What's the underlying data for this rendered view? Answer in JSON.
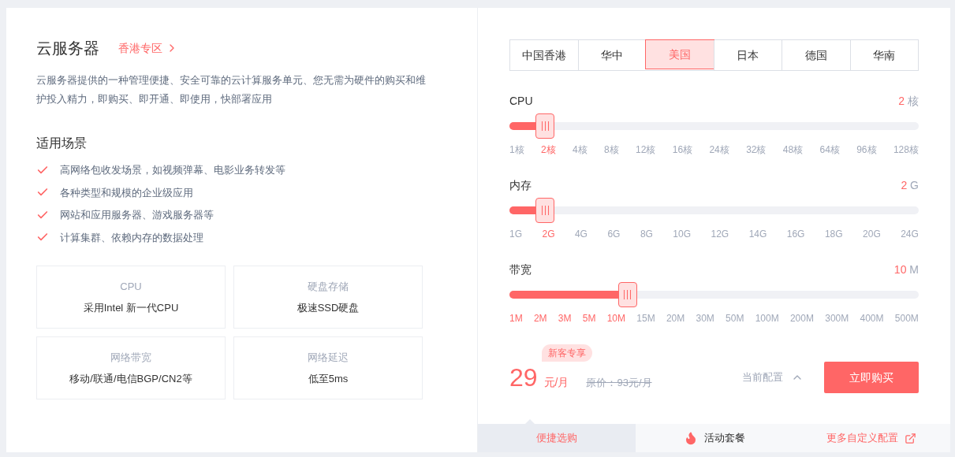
{
  "product": {
    "title": "云服务器",
    "zone_link": "香港专区",
    "description": "云服务器提供的一种管理便捷、安全可靠的云计算服务单元、您无需为硬件的购买和维护投入精力，即购买、即开通、即使用，快部署应用"
  },
  "scenarios": {
    "title": "适用场景",
    "items": [
      "高网络包收发场景，如视频弹幕、电影业务转发等",
      "各种类型和规模的企业级应用",
      "网站和应用服务器、游戏服务器等",
      "计算集群、依赖内存的数据处理"
    ]
  },
  "features": [
    {
      "label": "CPU",
      "value": "采用Intel 新一代CPU"
    },
    {
      "label": "硬盘存储",
      "value": "极速SSD硬盘"
    },
    {
      "label": "网络带宽",
      "value": "移动/联通/电信BGP/CN2等"
    },
    {
      "label": "网络延迟",
      "value": "低至5ms"
    }
  ],
  "regions": [
    {
      "label": "中国香港",
      "selected": false
    },
    {
      "label": "华中",
      "selected": false
    },
    {
      "label": "美国",
      "selected": true
    },
    {
      "label": "日本",
      "selected": false
    },
    {
      "label": "德国",
      "selected": false
    },
    {
      "label": "华南",
      "selected": false
    }
  ],
  "sliders": [
    {
      "label": "CPU",
      "value": "2",
      "unit": "核",
      "level": 0.087,
      "ticks": [
        {
          "text": "1核",
          "active": false
        },
        {
          "text": "2核",
          "active": true
        },
        {
          "text": "4核",
          "active": false
        },
        {
          "text": "8核",
          "active": false
        },
        {
          "text": "12核",
          "active": false
        },
        {
          "text": "16核",
          "active": false
        },
        {
          "text": "24核",
          "active": false
        },
        {
          "text": "32核",
          "active": false
        },
        {
          "text": "48核",
          "active": false
        },
        {
          "text": "64核",
          "active": false
        },
        {
          "text": "96核",
          "active": false
        },
        {
          "text": "128核",
          "active": false
        }
      ]
    },
    {
      "label": "内存",
      "value": "2",
      "unit": "G",
      "level": 0.087,
      "ticks": [
        {
          "text": "1G",
          "active": false
        },
        {
          "text": "2G",
          "active": true
        },
        {
          "text": "4G",
          "active": false
        },
        {
          "text": "6G",
          "active": false
        },
        {
          "text": "8G",
          "active": false
        },
        {
          "text": "10G",
          "active": false
        },
        {
          "text": "12G",
          "active": false
        },
        {
          "text": "14G",
          "active": false
        },
        {
          "text": "16G",
          "active": false
        },
        {
          "text": "18G",
          "active": false
        },
        {
          "text": "20G",
          "active": false
        },
        {
          "text": "24G",
          "active": false
        }
      ]
    },
    {
      "label": "带宽",
      "value": "10",
      "unit": "M",
      "level": 0.289,
      "ticks": [
        {
          "text": "1M",
          "active": true
        },
        {
          "text": "2M",
          "active": true
        },
        {
          "text": "3M",
          "active": true
        },
        {
          "text": "5M",
          "active": true
        },
        {
          "text": "10M",
          "active": true
        },
        {
          "text": "15M",
          "active": false
        },
        {
          "text": "20M",
          "active": false
        },
        {
          "text": "30M",
          "active": false
        },
        {
          "text": "50M",
          "active": false
        },
        {
          "text": "100M",
          "active": false
        },
        {
          "text": "200M",
          "active": false
        },
        {
          "text": "300M",
          "active": false
        },
        {
          "text": "400M",
          "active": false
        },
        {
          "text": "500M",
          "active": false
        }
      ]
    }
  ],
  "price": {
    "badge": "新客专享",
    "amount": "29",
    "unit": "元/月",
    "original": "原价：93元/月",
    "config_toggle": "当前配置",
    "buy_button": "立即购买"
  },
  "bottom_tabs": [
    {
      "label": "便捷选购",
      "selected": true,
      "kind": "plain"
    },
    {
      "label": "活动套餐",
      "selected": false,
      "kind": "hot"
    },
    {
      "label": "更多自定义配置",
      "selected": false,
      "kind": "external"
    }
  ]
}
